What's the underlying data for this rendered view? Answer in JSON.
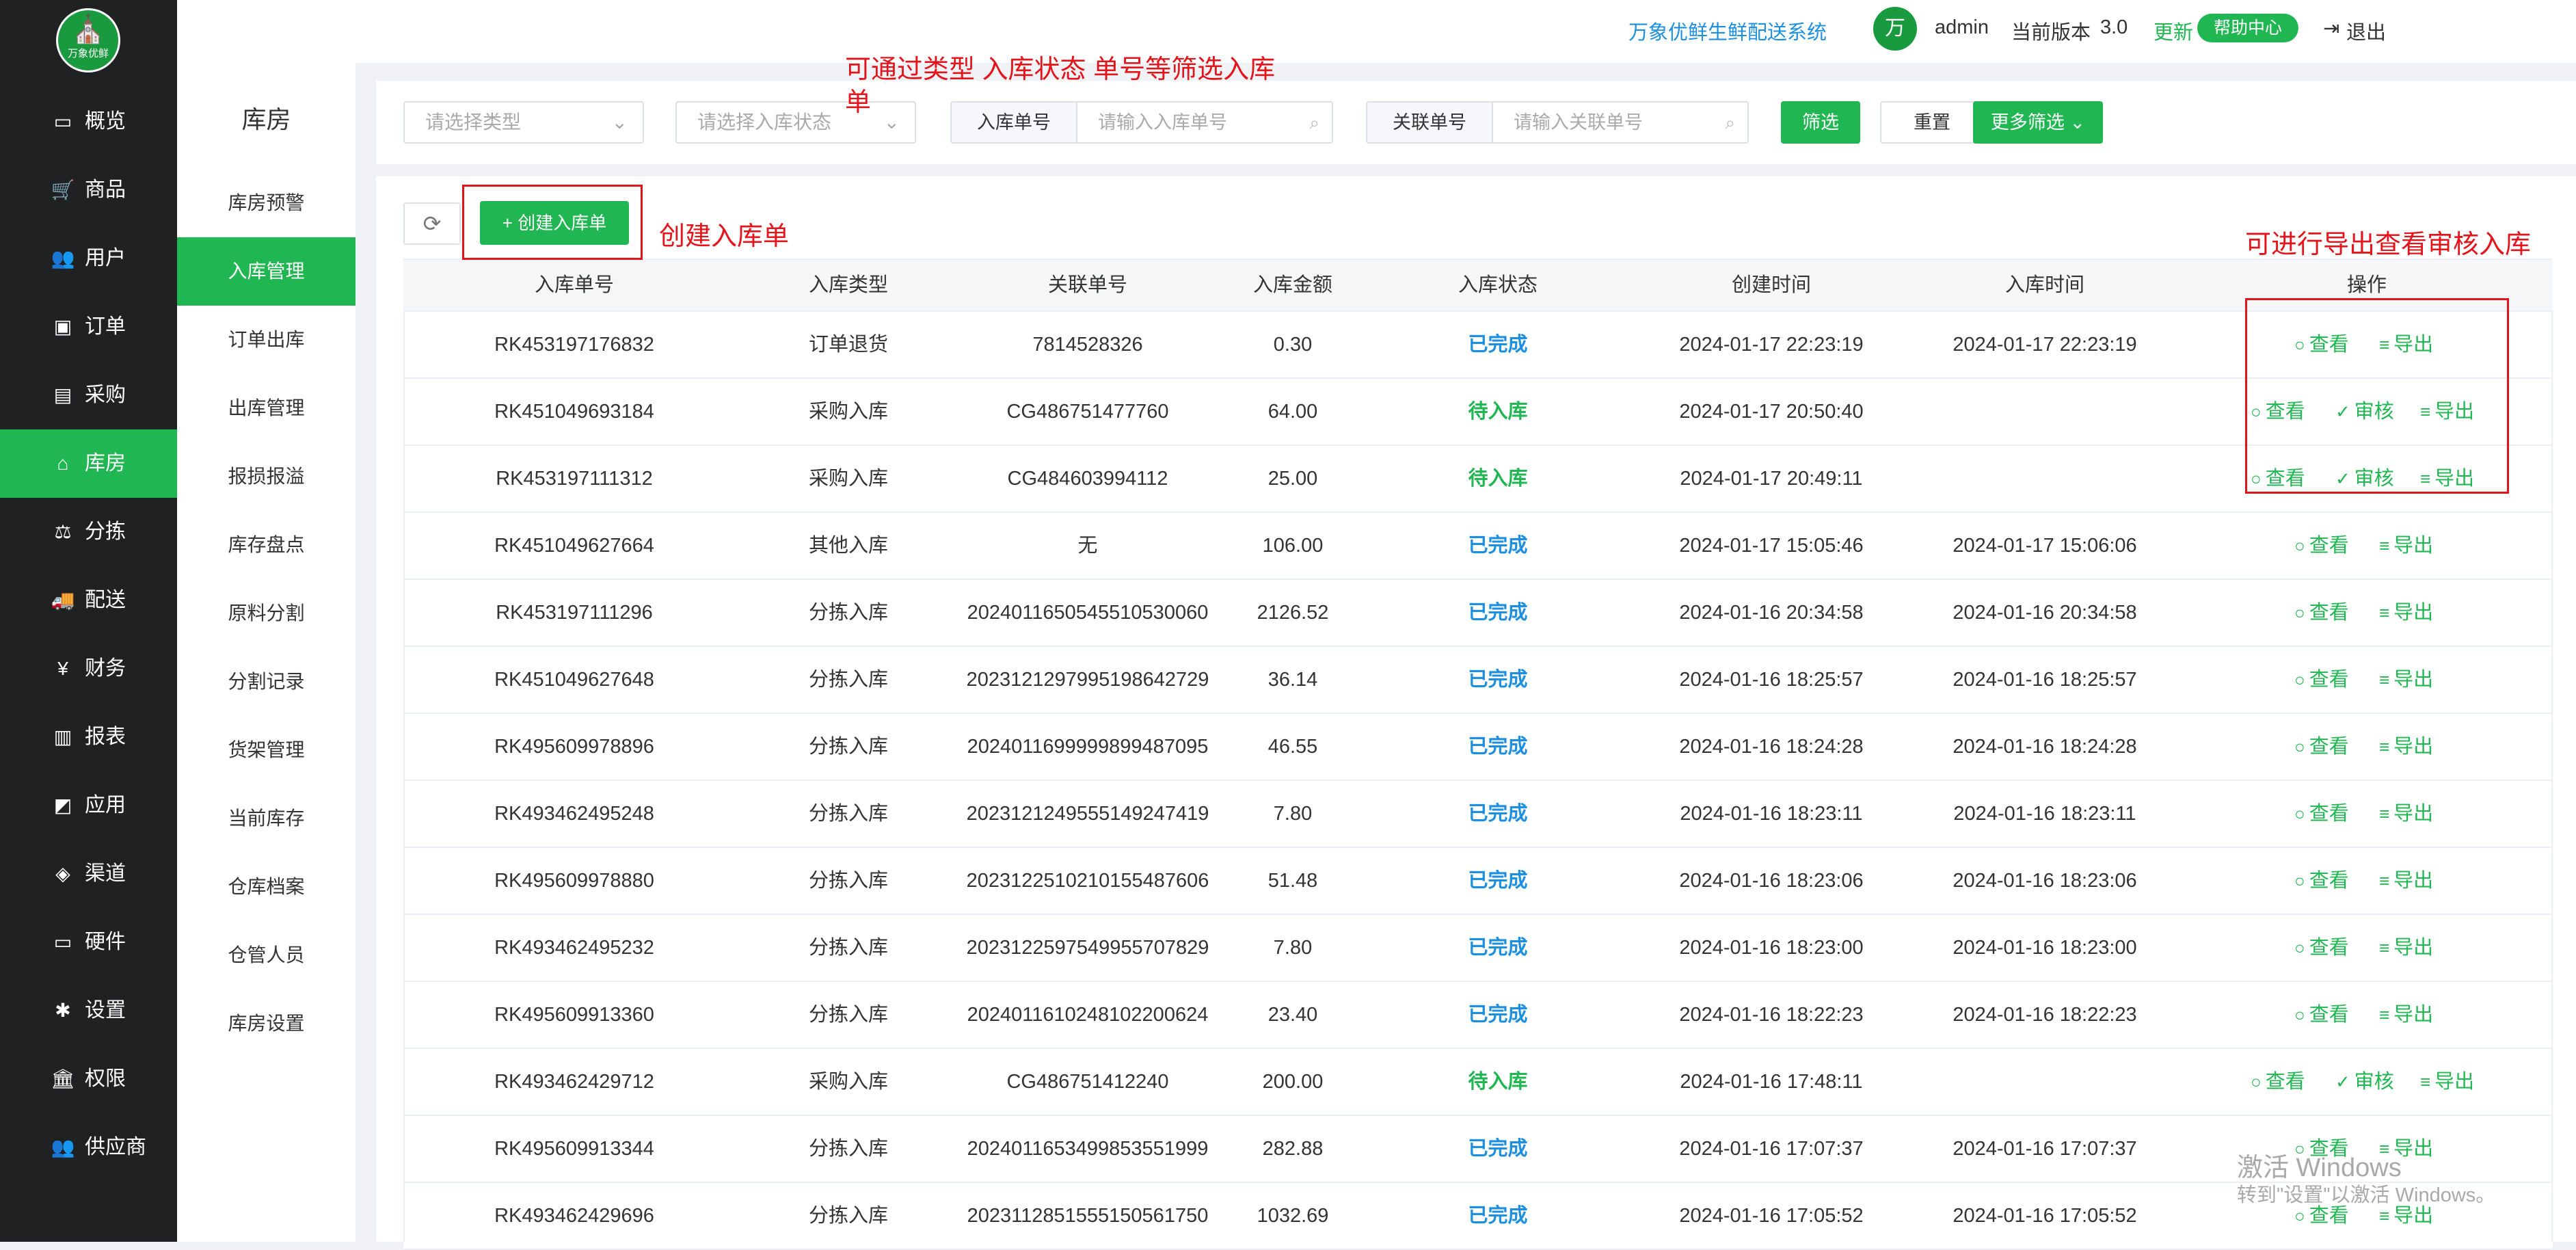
{
  "logo": {
    "glyph": "⛪",
    "text": "万象优鲜"
  },
  "nav": [
    {
      "icon": "▭",
      "label": "概览"
    },
    {
      "icon": "🛒",
      "label": "商品"
    },
    {
      "icon": "👥",
      "label": "用户"
    },
    {
      "icon": "▣",
      "label": "订单"
    },
    {
      "icon": "▤",
      "label": "采购"
    },
    {
      "icon": "⌂",
      "label": "库房"
    },
    {
      "icon": "⚖",
      "label": "分拣"
    },
    {
      "icon": "🚚",
      "label": "配送"
    },
    {
      "icon": "¥",
      "label": "财务"
    },
    {
      "icon": "▥",
      "label": "报表"
    },
    {
      "icon": "◩",
      "label": "应用"
    },
    {
      "icon": "◈",
      "label": "渠道"
    },
    {
      "icon": "▭",
      "label": "硬件"
    },
    {
      "icon": "✱",
      "label": "设置"
    },
    {
      "icon": "🏛",
      "label": "权限"
    },
    {
      "icon": "👥",
      "label": "供应商"
    }
  ],
  "subnav": {
    "title": "库房",
    "items": [
      "库房预警",
      "入库管理",
      "订单出库",
      "出库管理",
      "报损报溢",
      "库存盘点",
      "原料分割",
      "分割记录",
      "货架管理",
      "当前库存",
      "仓库档案",
      "仓管人员",
      "库房设置"
    ]
  },
  "header": {
    "system_name": "万象优鲜生鲜配送系统",
    "avatar_text": "万",
    "user": "admin",
    "version_label": "当前版本",
    "version": "3.0",
    "update": "更新",
    "help": "帮助中心",
    "logout": "退出"
  },
  "filters": {
    "type_placeholder": "请选择类型",
    "status_placeholder": "请选择入库状态",
    "order_label": "入库单号",
    "order_placeholder": "请输入入库单号",
    "related_label": "关联单号",
    "related_placeholder": "请输入关联单号",
    "filter_btn": "筛选",
    "reset_btn": "重置",
    "more_btn": "更多筛选"
  },
  "toolbar": {
    "create_btn": "+ 创建入库单"
  },
  "table": {
    "headers": [
      "入库单号",
      "入库类型",
      "关联单号",
      "入库金额",
      "入库状态",
      "创建时间",
      "入库时间",
      "操作"
    ],
    "actions": {
      "view": "查看",
      "audit": "审核",
      "export": "导出"
    },
    "rows": [
      {
        "id": "RK453197176832",
        "type": "订单退货",
        "related": "7814528326",
        "amount": "0.30",
        "status": "已完成",
        "created": "2024-01-17 22:23:19",
        "stored": "2024-01-17 22:23:19"
      },
      {
        "id": "RK451049693184",
        "type": "采购入库",
        "related": "CG486751477760",
        "amount": "64.00",
        "status": "待入库",
        "created": "2024-01-17 20:50:40",
        "stored": ""
      },
      {
        "id": "RK453197111312",
        "type": "采购入库",
        "related": "CG484603994112",
        "amount": "25.00",
        "status": "待入库",
        "created": "2024-01-17 20:49:11",
        "stored": ""
      },
      {
        "id": "RK451049627664",
        "type": "其他入库",
        "related": "无",
        "amount": "106.00",
        "status": "已完成",
        "created": "2024-01-17 15:05:46",
        "stored": "2024-01-17 15:06:06"
      },
      {
        "id": "RK453197111296",
        "type": "分拣入库",
        "related": "20240116505455105300​60",
        "amount": "2126.52",
        "status": "已完成",
        "created": "2024-01-16 20:34:58",
        "stored": "2024-01-16 20:34:58"
      },
      {
        "id": "RK451049627648",
        "type": "分拣入库",
        "related": "20231212979951986427​29",
        "amount": "36.14",
        "status": "已完成",
        "created": "2024-01-16 18:25:57",
        "stored": "2024-01-16 18:25:57"
      },
      {
        "id": "RK495609978896",
        "type": "分拣入库",
        "related": "20240116999998994870​95",
        "amount": "46.55",
        "status": "已完成",
        "created": "2024-01-16 18:24:28",
        "stored": "2024-01-16 18:24:28"
      },
      {
        "id": "RK493462495248",
        "type": "分拣入库",
        "related": "20231212495551492474​19",
        "amount": "7.80",
        "status": "已完成",
        "created": "2024-01-16 18:23:11",
        "stored": "2024-01-16 18:23:11"
      },
      {
        "id": "RK495609978880",
        "type": "分拣入库",
        "related": "20231225102101554876​06",
        "amount": "51.48",
        "status": "已完成",
        "created": "2024-01-16 18:23:06",
        "stored": "2024-01-16 18:23:06"
      },
      {
        "id": "RK493462495232",
        "type": "分拣入库",
        "related": "20231225975499557078​29",
        "amount": "7.80",
        "status": "已完成",
        "created": "2024-01-16 18:23:00",
        "stored": "2024-01-16 18:23:00"
      },
      {
        "id": "RK495609913360",
        "type": "分拣入库",
        "related": "20240116102481022006​24",
        "amount": "23.40",
        "status": "已完成",
        "created": "2024-01-16 18:22:23",
        "stored": "2024-01-16 18:22:23"
      },
      {
        "id": "RK493462429712",
        "type": "采购入库",
        "related": "CG486751412240",
        "amount": "200.00",
        "status": "待入库",
        "created": "2024-01-16 17:48:11",
        "stored": ""
      },
      {
        "id": "RK495609913344",
        "type": "分拣入库",
        "related": "20240116534998535519​99",
        "amount": "282.88",
        "status": "已完成",
        "created": "2024-01-16 17:07:37",
        "stored": "2024-01-16 17:07:37"
      },
      {
        "id": "RK493462429696",
        "type": "分拣入库",
        "related": "20231128515551505617​50",
        "amount": "1032.69",
        "status": "已完成",
        "created": "2024-01-16 17:05:52",
        "stored": "2024-01-16 17:05:52"
      }
    ]
  },
  "annotations": {
    "filter_note": "可通过类型 入库状态 单号等筛选入库单",
    "create_note": "创建入库单",
    "action_note": "可进行导出查看审核入库"
  },
  "watermark": {
    "line1": "激活 Windows",
    "line2": "转到\"设置\"以激活 Windows。"
  },
  "colors": {
    "accent": "#20b752",
    "done": "#1d8fe0",
    "sidebar": "#1f2122",
    "annotation": "#e4141b"
  }
}
